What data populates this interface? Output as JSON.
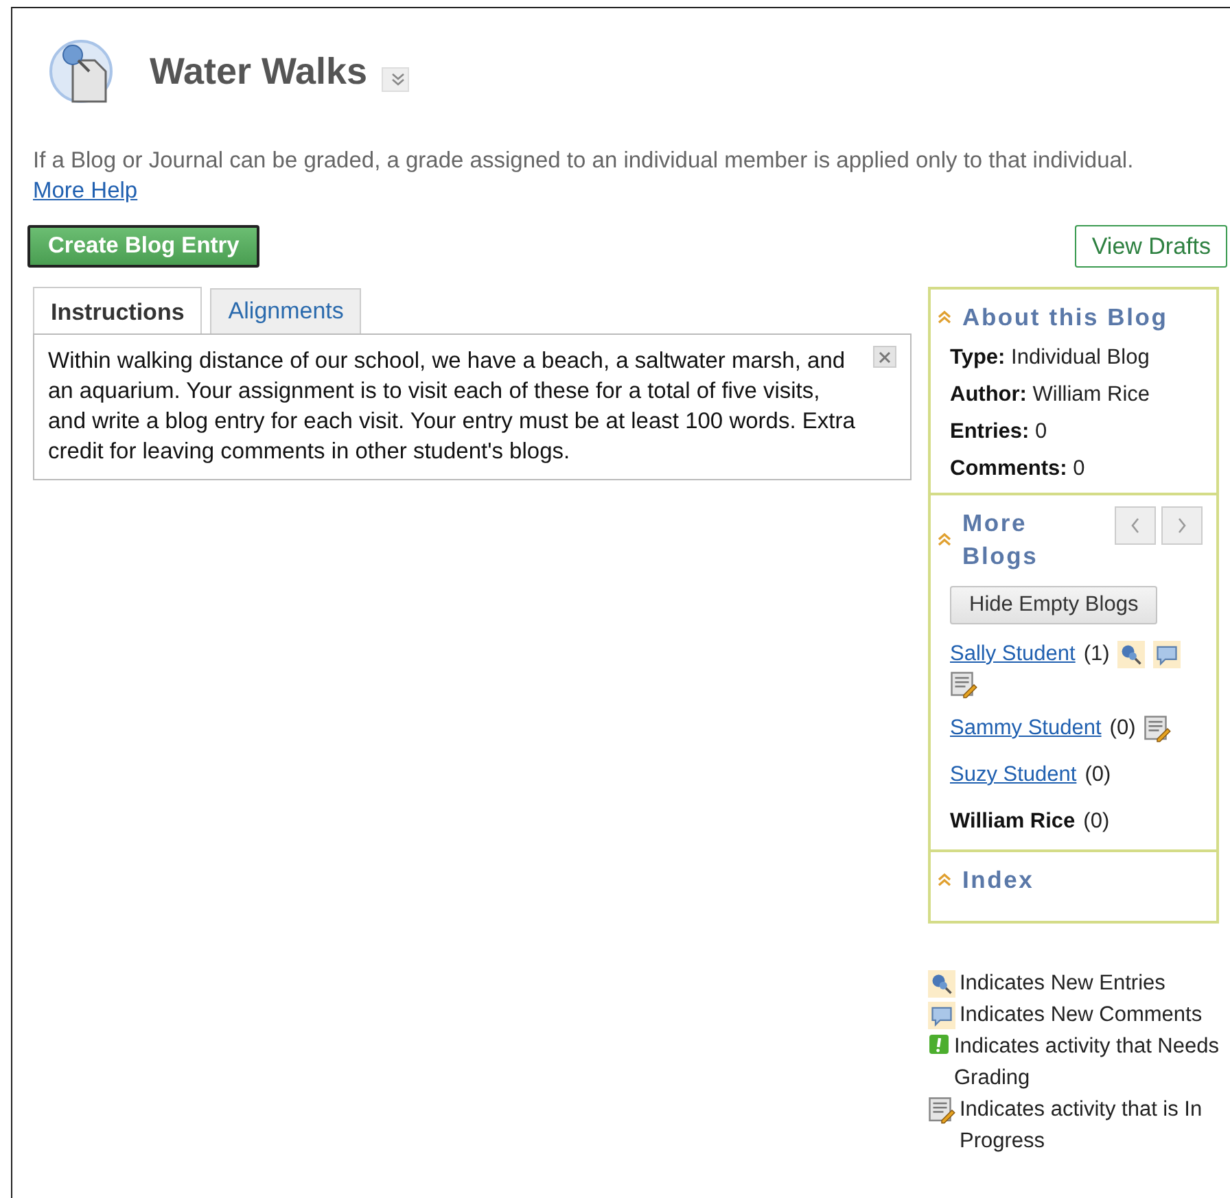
{
  "page": {
    "title": "Water Walks",
    "help_text": "If a Blog or Journal can be graded, a grade assigned to an individual member is applied only to that individual.",
    "help_link": "More Help"
  },
  "actions": {
    "create": "Create Blog Entry",
    "drafts": "View Drafts"
  },
  "tabs": [
    {
      "label": "Instructions",
      "selected": true
    },
    {
      "label": "Alignments",
      "selected": false
    }
  ],
  "instructions": " Within walking distance of our school, we have a beach, a saltwater marsh, and an aquarium. Your assignment is to visit each of these for a total of five visits, and write a blog entry for each visit. Your entry must be at least 100 words. Extra credit for leaving comments in other student's blogs.",
  "about": {
    "title": "About this Blog",
    "fields": [
      {
        "label": "Type:",
        "value": "Individual Blog"
      },
      {
        "label": "Author:",
        "value": "William Rice"
      },
      {
        "label": "Entries:",
        "value": "0"
      },
      {
        "label": "Comments:",
        "value": "0"
      }
    ]
  },
  "more_blogs": {
    "title": "More Blogs",
    "button": "Hide Empty Blogs",
    "blogs": [
      {
        "name": "Sally Student",
        "link": true,
        "count": "(1)",
        "new_entries": true,
        "new_comments": true,
        "in_progress": true
      },
      {
        "name": "Sammy Student",
        "link": true,
        "count": "(0)",
        "new_entries": false,
        "new_comments": false,
        "in_progress": true
      },
      {
        "name": "Suzy Student",
        "link": true,
        "count": "(0)",
        "new_entries": false,
        "new_comments": false,
        "in_progress": false
      },
      {
        "name": "William Rice",
        "link": false,
        "count": "(0)",
        "new_entries": false,
        "new_comments": false,
        "in_progress": false
      }
    ]
  },
  "index": {
    "title": "Index"
  },
  "legend": [
    {
      "kind": "new_entries",
      "text": "Indicates New Entries"
    },
    {
      "kind": "new_comments",
      "text": "Indicates New Comments"
    },
    {
      "kind": "needs_grading",
      "text": "Indicates activity that Needs Grading"
    },
    {
      "kind": "in_progress",
      "text": "Indicates activity that is In Progress"
    }
  ]
}
